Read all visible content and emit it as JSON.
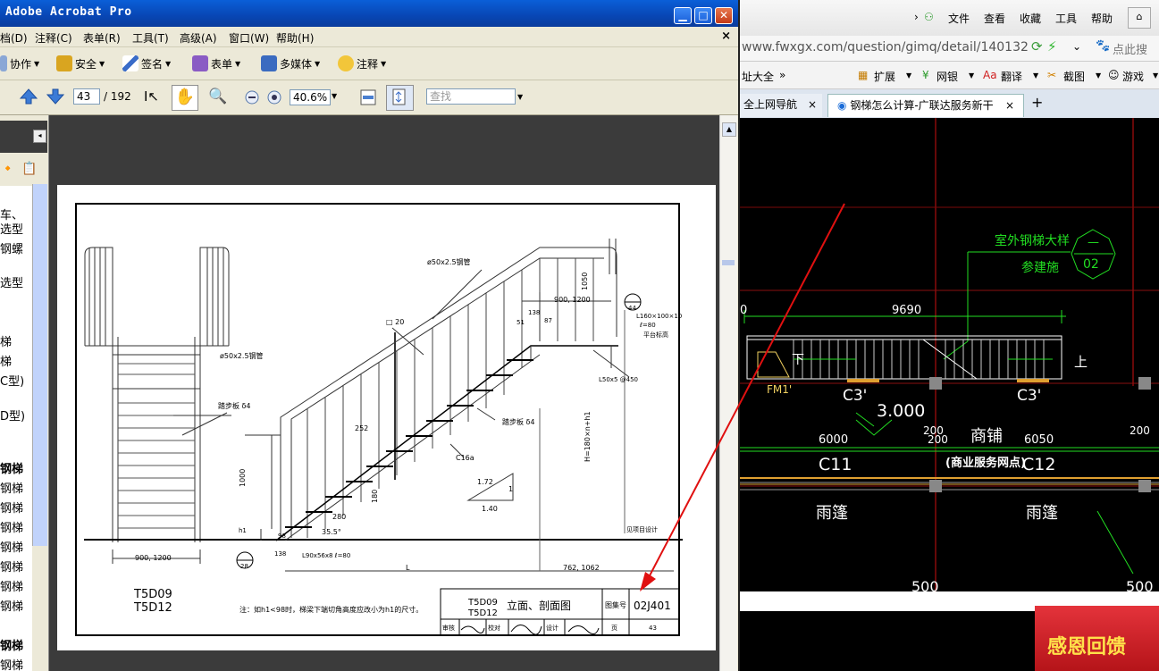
{
  "acrobat": {
    "title": "Adobe Acrobat Pro",
    "menu": [
      "档(D)",
      "注释(C)",
      "表单(R)",
      "工具(T)",
      "高级(A)",
      "窗口(W)",
      "帮助(H)"
    ],
    "close_doc": "×",
    "toolbar1": [
      "协作",
      "安全",
      "签名",
      "表单",
      "多媒体",
      "注释"
    ],
    "page_current": "43",
    "page_total": "/ 192",
    "zoom": "40.6%",
    "find_placeholder": "查找",
    "sidebar_items": [
      "车、",
      "选型",
      "钢螺",
      "选型",
      "梯",
      "梯",
      "C型)",
      "D型)",
      "钢梯",
      "钢梯",
      "钢梯",
      "钢梯",
      "钢梯",
      "钢梯",
      "钢梯",
      "钢梯",
      "钢梯",
      "钢梯"
    ]
  },
  "drawing": {
    "labels": {
      "pipe_top": "ø50x2.5钢管",
      "pipe_left": "ø50x2.5钢管",
      "square": "□ 20",
      "tread_left": "踏步板 δ4",
      "tread_right": "踏步板 δ4",
      "channel": "C16a",
      "angle_top": "L160×100×10",
      "angle_l": "ℓ=80",
      "platform": "平台标高",
      "angle_bottom": "L50x5 @450",
      "angle_foot": "L90x56x8  ℓ=80",
      "see_project": "见项目设计",
      "slope_a": "1.72",
      "slope_b": "1",
      "slope_c": "1.40",
      "h_total": "H=180×n+h1",
      "circle_top": "44",
      "circle_bot": "28",
      "note": "注：如h1<98时，梯梁下端切角高度应改小为h1的尺寸。"
    },
    "dims": {
      "d1050": "1050",
      "d900_1200_top": "900, 1200",
      "d138_top": "138",
      "d51": "51",
      "d87": "87",
      "d252": "252",
      "d180": "180",
      "d1000": "1000",
      "d280": "280",
      "d35": "35.5°",
      "d98": "98",
      "dh1": "h1",
      "d138_bot": "138",
      "d900_1200_bot": "900, 1200",
      "dL": "L",
      "d762": "762, 1062"
    },
    "codes_left": [
      "T5D09",
      "T5D12"
    ],
    "title_block": {
      "codes": [
        "T5D09",
        "T5D12"
      ],
      "name": "立面、剖面图",
      "set_label": "图集号",
      "set_no": "02J401",
      "review": "审核",
      "check": "校对",
      "design": "设计",
      "page_label": "页",
      "page_no": "43"
    }
  },
  "browser": {
    "menu": [
      "文件",
      "查看",
      "收藏",
      "工具",
      "帮助"
    ],
    "url": "www.fwxgx.com/question/gimq/detail/1401328.ht",
    "search_placeholder": "点此搜",
    "bookmarks": [
      "址大全",
      "扩展",
      "网银",
      "翻译",
      "截图",
      "游戏"
    ],
    "tabs": [
      "全上网导航",
      "钢梯怎么计算-广联达服务新干"
    ],
    "tab_close": "×",
    "new_tab": "+",
    "cad": {
      "heading": "室外钢梯大样",
      "sub": "参建施",
      "hex_top": "—",
      "hex_bot": "02",
      "dim_main": "9690",
      "dim_left": "0",
      "fm": "FM1'",
      "c3a": "C3'",
      "c3b": "C3'",
      "elev": "3.000",
      "d6000": "6000",
      "d200a": "200",
      "d200b": "200",
      "d6050": "6050",
      "d200c": "200",
      "shop": "商铺",
      "c11": "C11",
      "c12": "C12",
      "service": "(商业服务网点)",
      "canopy1": "雨篷",
      "canopy2": "雨篷",
      "d500a": "500",
      "d500b": "500",
      "up": "上",
      "down": "下"
    },
    "ad_text": "感恩回馈"
  },
  "colors": {
    "titlebar": "#0846b4",
    "cad_green": "#22dd22",
    "cad_red": "#e01010",
    "arrow": "#e01010"
  }
}
